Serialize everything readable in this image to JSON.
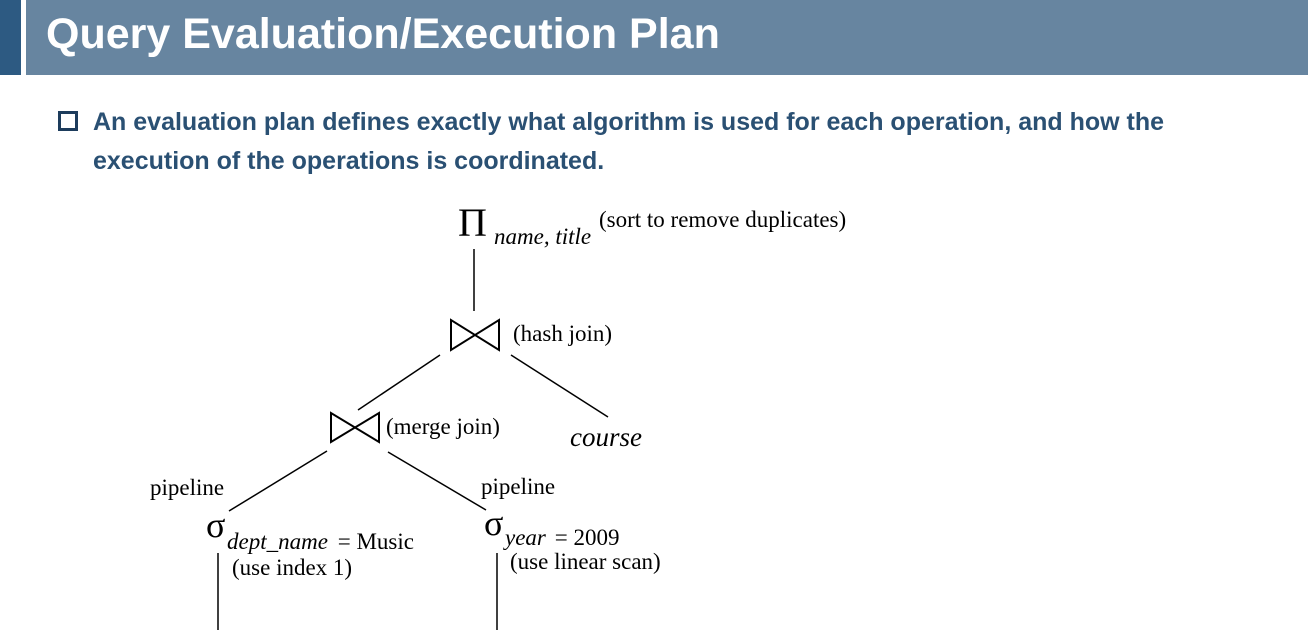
{
  "slide": {
    "title": "Query Evaluation/Execution Plan",
    "bullet": "An evaluation plan defines exactly what algorithm is used for each operation, and how the execution of the operations is coordinated."
  },
  "diagram": {
    "projection": {
      "symbol": "Π",
      "subscript": "name, title",
      "annotation": "(sort to remove duplicates)"
    },
    "hash_join": {
      "annotation": "(hash join)"
    },
    "merge_join": {
      "annotation": "(merge join)"
    },
    "course": "course",
    "pipeline_left": "pipeline",
    "pipeline_right": "pipeline",
    "select_left": {
      "symbol": "σ",
      "subscript_italic": "dept_name",
      "condition": " = Music",
      "annotation": "(use index 1)"
    },
    "select_right": {
      "symbol": "σ",
      "subscript_italic": "year",
      "condition": " = 2009",
      "annotation": "(use linear scan)"
    }
  }
}
